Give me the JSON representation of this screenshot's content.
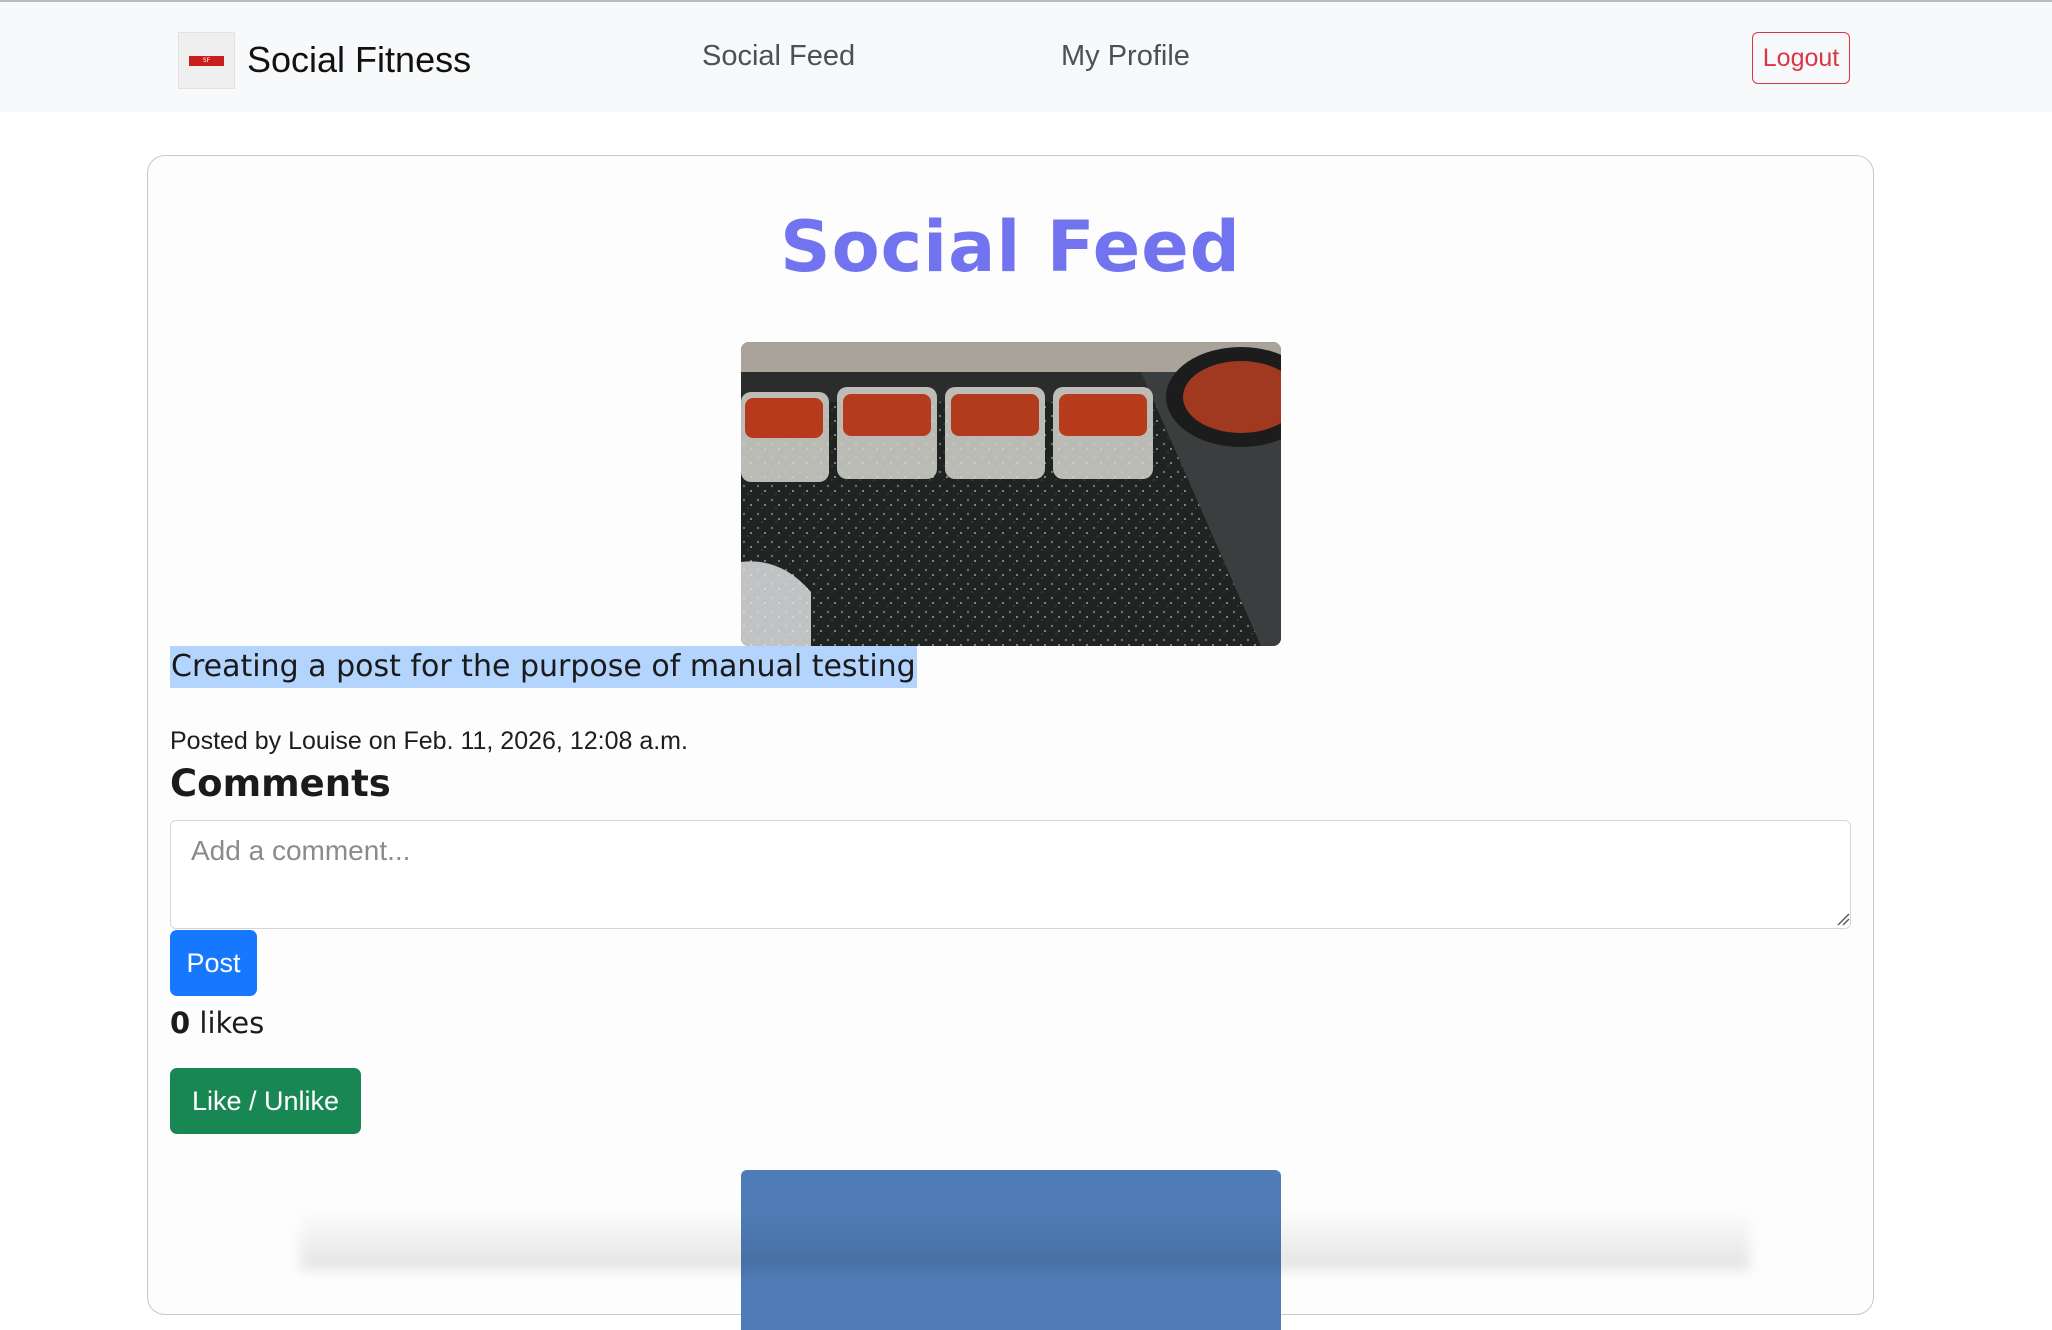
{
  "navbar": {
    "brand": "Social Fitness",
    "links": [
      "Social Feed",
      "My Profile"
    ],
    "logout_label": "Logout"
  },
  "feed": {
    "title": "Social Feed",
    "post": {
      "caption": "Creating a post for the purpose of manual testing",
      "meta": "Posted by Louise on Feb. 11, 2026, 12:08 a.m.",
      "comments_heading": "Comments",
      "comment_placeholder": "Add a comment...",
      "post_button": "Post",
      "likes_count": "0",
      "likes_label": "likes",
      "like_button": "Like / Unlike"
    }
  },
  "colors": {
    "title": "#7173ef",
    "post_button": "#1677ff",
    "like_button": "#198754",
    "logout": "#dc3545"
  }
}
